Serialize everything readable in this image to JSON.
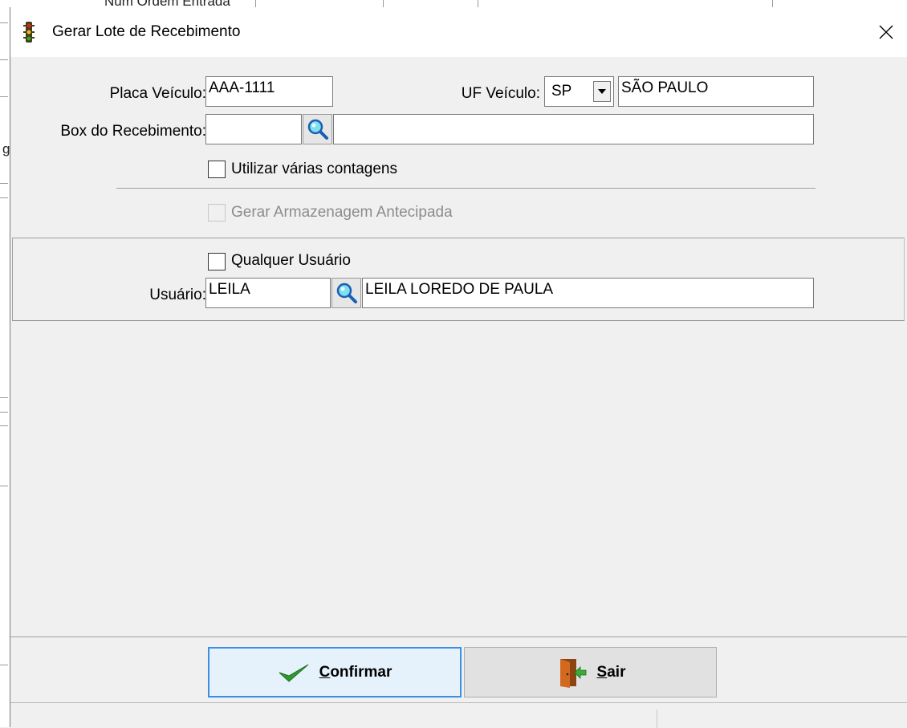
{
  "background": {
    "top_text": "Num Ordem Entrada",
    "left_glyph": "g"
  },
  "dialog": {
    "title": "Gerar Lote de Recebimento",
    "title_icon": "traffic-light-icon",
    "close_icon": "close-icon"
  },
  "form": {
    "placa_label": "Placa Veículo:",
    "placa_value": "AAA-1111",
    "uf_label": "UF Veículo:",
    "uf_value": "SP",
    "uf_name": "SÃO PAULO",
    "box_label": "Box do Recebimento:",
    "box_code": "",
    "box_desc": "",
    "varias_contagens_label": "Utilizar várias contagens",
    "varias_contagens_checked": false,
    "armazenagem_label": "Gerar Armazenagem Antecipada",
    "armazenagem_checked": false,
    "armazenagem_enabled": false
  },
  "user_panel": {
    "qualquer_label": "Qualquer Usuário",
    "qualquer_checked": false,
    "usuario_label": "Usuário:",
    "usuario_code": "LEILA",
    "usuario_name": "LEILA LOREDO DE PAULA"
  },
  "buttons": {
    "confirm_accel": "C",
    "confirm_rest": "onfirmar",
    "sair_accel": "S",
    "sair_rest": "air"
  },
  "colors": {
    "accent": "#3a8ee6",
    "confirm_bg": "#e5f1fb",
    "check_green": "#2e9a2e",
    "door_orange": "#d2691e"
  }
}
